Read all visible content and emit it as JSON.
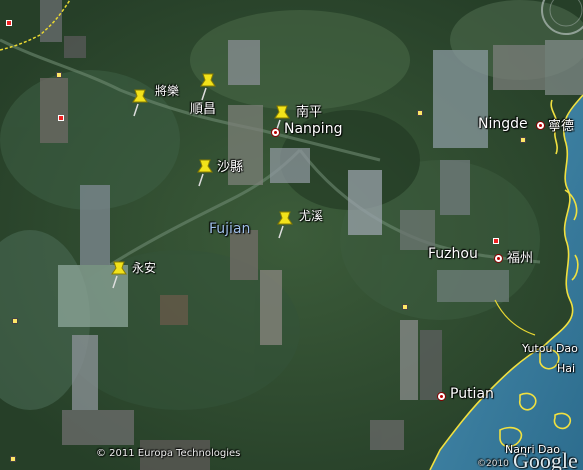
{
  "map": {
    "region_label": "Fujian",
    "pins": [
      {
        "label": "將樂"
      },
      {
        "label": "順昌"
      },
      {
        "label": "南平"
      },
      {
        "label": "沙縣"
      },
      {
        "label": "尤溪"
      },
      {
        "label": "永安"
      }
    ],
    "cities": [
      {
        "name": "Nanping"
      },
      {
        "name": "Ningde",
        "name_local": "寧德"
      },
      {
        "name": "Fuzhou",
        "name_local": "福州"
      },
      {
        "name": "Putian"
      }
    ],
    "sea_labels": [
      "Yutou Dao",
      "Hai",
      "Nanri Dao"
    ],
    "copyright": "© 2011 Europa Technologies",
    "logo": "Google",
    "logo_year": "©2010"
  },
  "colors": {
    "forest": "#2f4c2f",
    "sea": "#3b7ea0",
    "coast": "#f0e040",
    "pin": "#f2e21a"
  }
}
